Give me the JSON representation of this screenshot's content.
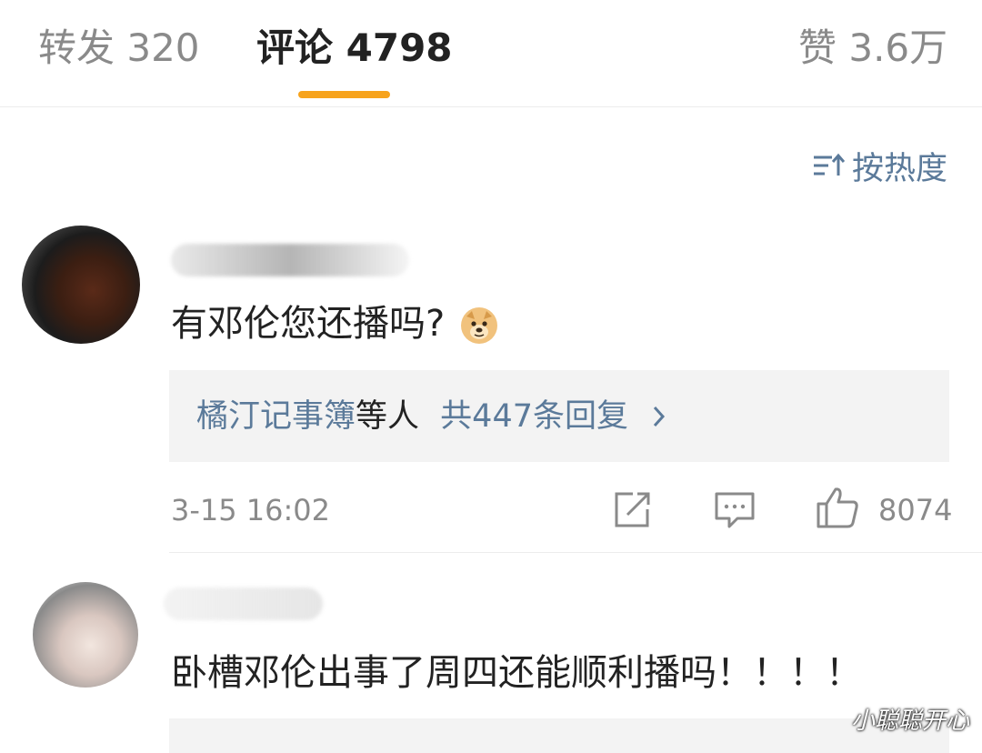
{
  "tabs": {
    "repost": "转发 320",
    "comments": "评论 4798",
    "likes": "赞 3.6万"
  },
  "sort": {
    "label": "按热度"
  },
  "comments": [
    {
      "text": "有邓伦您还播吗?",
      "reply_user": "橘汀记事簿",
      "reply_mid": "等人",
      "reply_count": "共447条回复",
      "time": "3-15 16:02",
      "likes": "8074"
    },
    {
      "text": "卧槽邓伦出事了周四还能顺利播吗！！！！"
    }
  ],
  "watermark": "小聪聪开心",
  "colors": {
    "accent": "#f7a31c",
    "link": "#5b7a9a"
  }
}
